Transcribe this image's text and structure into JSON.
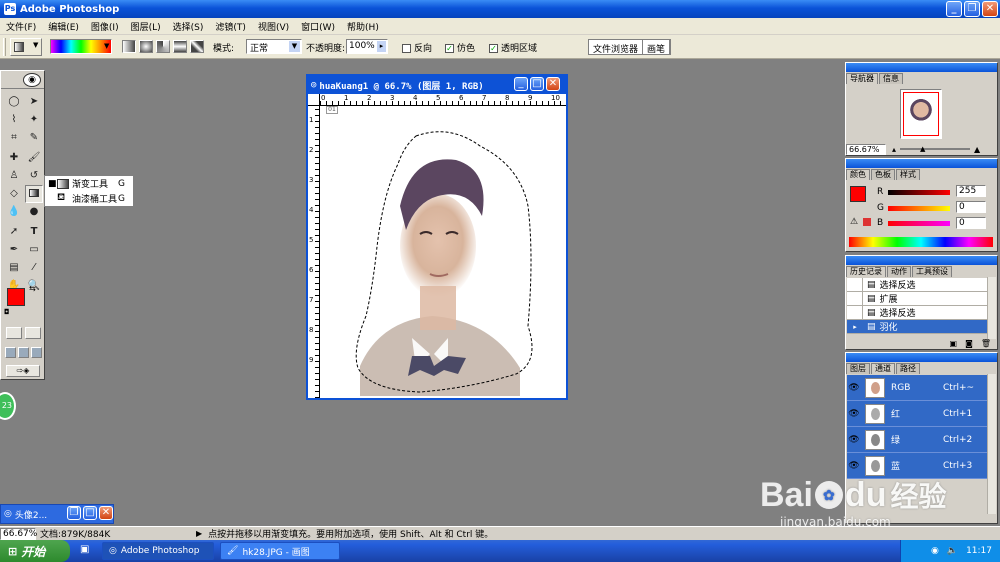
{
  "app": {
    "title": "Adobe Photoshop",
    "icon": "photoshop-icon"
  },
  "menu": [
    "文件(F)",
    "编辑(E)",
    "图像(I)",
    "图层(L)",
    "选择(S)",
    "滤镜(T)",
    "视图(V)",
    "窗口(W)",
    "帮助(H)"
  ],
  "options": {
    "mode_label": "模式:",
    "mode_value": "正常",
    "opacity_label": "不透明度:",
    "opacity_value": "100%",
    "reverse_label": "反向",
    "dither_label": "仿色",
    "transparency_label": "透明区域",
    "file_browser_tab": "文件浏览器",
    "brushes_tab": "画笔"
  },
  "flyout": {
    "items": [
      {
        "name": "渐变工具",
        "key": "G"
      },
      {
        "name": "油漆桶工具",
        "key": "G"
      }
    ]
  },
  "document": {
    "title": "huaKuang1 @ 66.7% (图层 1, RGB)",
    "ruler_top": [
      "0",
      "1",
      "2",
      "3",
      "4",
      "5",
      "6",
      "7",
      "8",
      "9",
      "10"
    ],
    "ruler_left": [
      "1",
      "2",
      "3",
      "4",
      "5",
      "6",
      "7",
      "8",
      "9"
    ]
  },
  "navigator": {
    "tabs": [
      "导航器",
      "信息"
    ],
    "zoom": "66.67%"
  },
  "color": {
    "tabs": [
      "颜色",
      "色板",
      "样式"
    ],
    "r_label": "R",
    "g_label": "G",
    "b_label": "B",
    "r": "255",
    "g": "0",
    "b": "0",
    "fg": "#ff0000",
    "bg": "#0000ff"
  },
  "history": {
    "tabs": [
      "历史记录",
      "动作",
      "工具预设"
    ],
    "items": [
      {
        "name": "选择反选",
        "selected": false
      },
      {
        "name": "扩展",
        "selected": false
      },
      {
        "name": "选择反选",
        "selected": false
      },
      {
        "name": "羽化",
        "selected": true
      }
    ]
  },
  "channels": {
    "tabs": [
      "图层",
      "通道",
      "路径"
    ],
    "items": [
      {
        "name": "RGB",
        "shortcut": "Ctrl+~"
      },
      {
        "name": "红",
        "shortcut": "Ctrl+1"
      },
      {
        "name": "绿",
        "shortcut": "Ctrl+2"
      },
      {
        "name": "蓝",
        "shortcut": "Ctrl+3"
      }
    ]
  },
  "minimized": {
    "title": "头像2..."
  },
  "status": {
    "zoom": "66.67%",
    "doc_size": "文档:879K/884K",
    "hint": "点按并拖移以用渐变填充。要用附加选项，使用 Shift、Alt 和 Ctrl 键。"
  },
  "taskbar": {
    "start": "开始",
    "tasks": [
      "Adobe Photoshop",
      "hk28.JPG - 画图"
    ],
    "clock": "11:17"
  },
  "badge": "23",
  "watermark": {
    "brand": "Bai",
    "brand2": "du",
    "cn": "经验",
    "url": "jingyan.baidu.com"
  }
}
